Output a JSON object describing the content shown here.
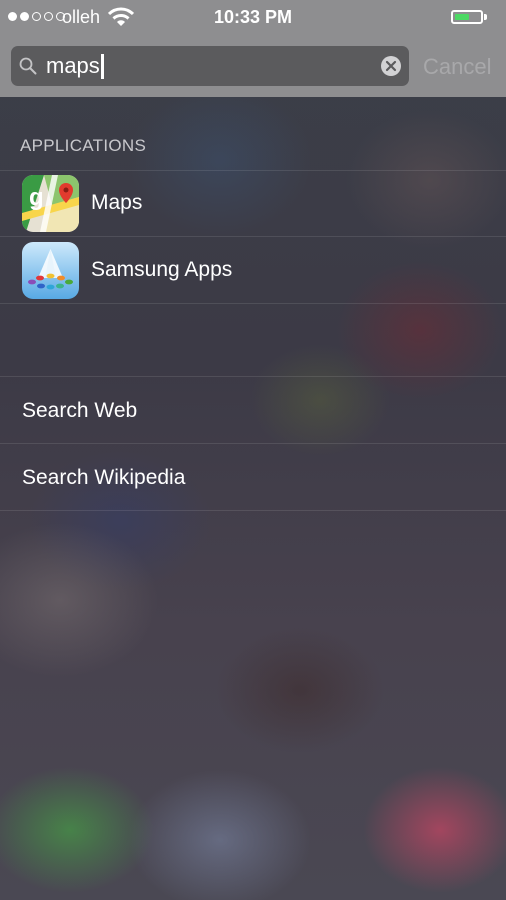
{
  "status_bar": {
    "carrier": "olleh",
    "time": "10:33 PM",
    "signal_strength": 2,
    "signal_max": 5,
    "battery_level": 0.6,
    "battery_color": "#4cd964",
    "wifi_icon": "wifi-icon"
  },
  "search": {
    "query": "maps",
    "search_icon": "magnifier-icon",
    "clear_icon": "clear-icon",
    "cancel_label": "Cancel"
  },
  "results": {
    "section_title": "APPLICATIONS",
    "apps": [
      {
        "name": "Maps",
        "icon": "google-maps-icon"
      },
      {
        "name": "Samsung Apps",
        "icon": "samsung-apps-icon"
      }
    ],
    "actions": [
      {
        "label": "Search Web"
      },
      {
        "label": "Search Wikipedia"
      }
    ]
  }
}
